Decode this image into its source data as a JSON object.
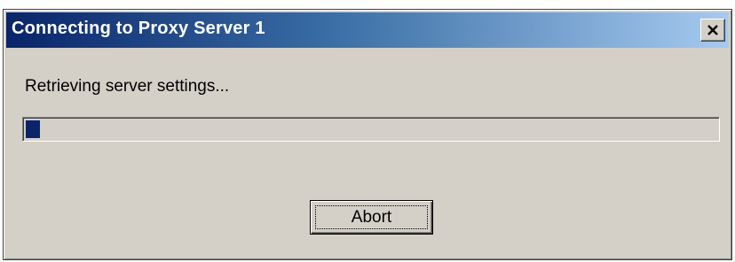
{
  "window": {
    "title": "Connecting to Proxy Server 1"
  },
  "title_bar": {
    "close_icon": "close-x-icon",
    "gradient_colors": [
      "#0a246a",
      "#a6caf0"
    ]
  },
  "body": {
    "message": "Retrieving server settings..."
  },
  "progress": {
    "fraction": 0.02,
    "fill_color": "#0a246a"
  },
  "buttons": {
    "abort_label": "Abort"
  }
}
